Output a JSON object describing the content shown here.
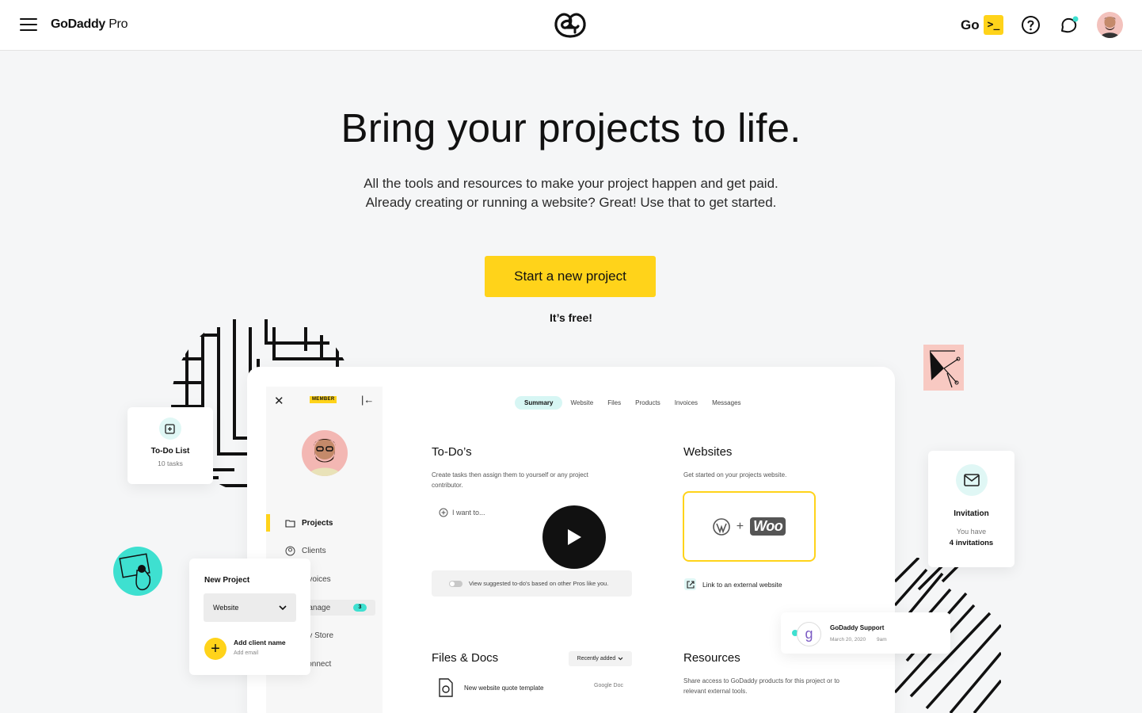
{
  "header": {
    "brand": "GoDaddy",
    "brand_suffix": "Pro",
    "go_label": "Go",
    "go_button": ">_"
  },
  "hero": {
    "title": "Bring your projects to life.",
    "subtitle_line1": "All the tools and resources to make your project happen and get paid.",
    "subtitle_line2": "Already creating or running a website?  Great! Use that to get started.",
    "cta": "Start a new project",
    "free_note": "It’s free!"
  },
  "dashboard": {
    "member_badge": "MEMBER",
    "sidebar": {
      "items": [
        {
          "label": "Projects"
        },
        {
          "label": "Clients"
        },
        {
          "label": "Invoices"
        },
        {
          "label": "Manage",
          "badge": "3"
        },
        {
          "label": "My Store"
        },
        {
          "label": "Connect"
        }
      ]
    },
    "tabs": [
      "Summary",
      "Website",
      "Files",
      "Products",
      "Invoices",
      "Messages"
    ],
    "todos": {
      "title": "To-Do’s",
      "desc": "Create tasks then assign them to yourself or any project contributor.",
      "input_placeholder": "I want to...",
      "suggest": "View suggested to-do's based on other Pros like you."
    },
    "websites": {
      "title": "Websites",
      "desc": "Get started on your projects website.",
      "plus": "+",
      "woo": "Woo",
      "link": "Link to an external website"
    },
    "files": {
      "title": "Files & Docs",
      "sort": "Recently added",
      "doc_name": "New website quote template",
      "doc_type": "Google Doc"
    },
    "resources": {
      "title": "Resources",
      "desc": "Share access to GoDaddy products for this project or to relevant external tools."
    }
  },
  "cards": {
    "todo": {
      "title": "To-Do List",
      "sub": "10 tasks"
    },
    "new_project": {
      "title": "New Project",
      "select": "Website",
      "add_name": "Add client name",
      "add_email": "Add email"
    },
    "invitation": {
      "title": "Invitation",
      "sub1": "You have",
      "sub2": "4 invitations"
    },
    "support": {
      "letter": "g",
      "name": "GoDaddy Support",
      "date": "March 20, 2020",
      "time": "9am"
    }
  }
}
